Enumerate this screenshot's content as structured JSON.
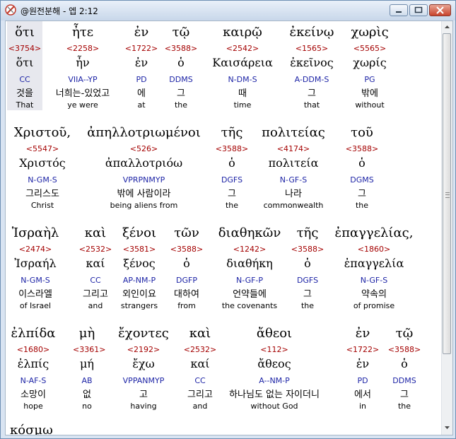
{
  "window": {
    "title": "@원전분해 - 엡 2:12"
  },
  "rows": [
    {
      "words": [
        {
          "greek": "ὅτι",
          "strong": "<3754>",
          "lexeme": "ὅτι",
          "parsing": "CC",
          "korean": "것을",
          "english": "That"
        },
        {
          "greek": "ἦτε",
          "strong": "<2258>",
          "lexeme": "ἦν",
          "parsing": "VIIA--YP",
          "korean": "너희는-있었고",
          "english": "ye were"
        },
        {
          "greek": "ἐν",
          "strong": "<1722>",
          "lexeme": "ἐν",
          "parsing": "PD",
          "korean": "에",
          "english": "at"
        },
        {
          "greek": "τῷ",
          "strong": "<3588>",
          "lexeme": "ὁ",
          "parsing": "DDMS",
          "korean": "그",
          "english": "the"
        },
        {
          "greek": "καιρῷ",
          "strong": "<2542>",
          "lexeme": "Καισάρεια",
          "parsing": "N-DM-S",
          "korean": "때",
          "english": "time"
        },
        {
          "greek": "ἐκείνῳ",
          "strong": "<1565>",
          "lexeme": "ἐκεῖνος",
          "parsing": "A-DDM-S",
          "korean": "그",
          "english": "that"
        },
        {
          "greek": "χωρὶς",
          "strong": "<5565>",
          "lexeme": "χωρίς",
          "parsing": "PG",
          "korean": "밖에",
          "english": "without"
        }
      ]
    },
    {
      "words": [
        {
          "greek": "Χριστοῦ,",
          "strong": "<5547>",
          "lexeme": "Χριστός",
          "parsing": "N-GM-S",
          "korean": "그리스도",
          "english": "Christ"
        },
        {
          "greek": "ἀπηλλοτριωμένοι",
          "strong": "<526>",
          "lexeme": "ἀπαλλοτριόω",
          "parsing": "VPRPNMYP",
          "korean": "밖에 사람이라",
          "english": "being aliens from"
        },
        {
          "greek": "τῆς",
          "strong": "<3588>",
          "lexeme": "ὁ",
          "parsing": "DGFS",
          "korean": "그",
          "english": "the"
        },
        {
          "greek": "πολιτείας",
          "strong": "<4174>",
          "lexeme": "πολιτεία",
          "parsing": "N-GF-S",
          "korean": "나라",
          "english": "commonwealth"
        },
        {
          "greek": "τοῦ",
          "strong": "<3588>",
          "lexeme": "ὁ",
          "parsing": "DGMS",
          "korean": "그",
          "english": "the"
        }
      ]
    },
    {
      "words": [
        {
          "greek": "Ἰσραὴλ",
          "strong": "<2474>",
          "lexeme": "Ἰσραήλ",
          "parsing": "N-GM-S",
          "korean": "이스라엘",
          "english": "of Israel"
        },
        {
          "greek": "καὶ",
          "strong": "<2532>",
          "lexeme": "καί",
          "parsing": "CC",
          "korean": "그리고",
          "english": "and"
        },
        {
          "greek": "ξένοι",
          "strong": "<3581>",
          "lexeme": "ξένος",
          "parsing": "AP-NM-P",
          "korean": "외인이요",
          "english": "strangers"
        },
        {
          "greek": "τῶν",
          "strong": "<3588>",
          "lexeme": "ὁ",
          "parsing": "DGFP",
          "korean": "대하여",
          "english": "from"
        },
        {
          "greek": "διαθηκῶν",
          "strong": "<1242>",
          "lexeme": "διαθήκη",
          "parsing": "N-GF-P",
          "korean": "언약들에",
          "english": "the covenants"
        },
        {
          "greek": "τῆς",
          "strong": "<3588>",
          "lexeme": "ὁ",
          "parsing": "DGFS",
          "korean": "그",
          "english": "the"
        },
        {
          "greek": "ἐπαγγελίας,",
          "strong": "<1860>",
          "lexeme": "ἐπαγγελία",
          "parsing": "N-GF-S",
          "korean": "약속의",
          "english": "of promise"
        }
      ]
    },
    {
      "words": [
        {
          "greek": "ἐλπίδα",
          "strong": "<1680>",
          "lexeme": "ἐλπίς",
          "parsing": "N-AF-S",
          "korean": "소망이",
          "english": "hope"
        },
        {
          "greek": "μὴ",
          "strong": "<3361>",
          "lexeme": "μή",
          "parsing": "AB",
          "korean": "없",
          "english": "no"
        },
        {
          "greek": "ἔχοντες",
          "strong": "<2192>",
          "lexeme": "ἔχω",
          "parsing": "VPPANMYP",
          "korean": "고",
          "english": "having"
        },
        {
          "greek": "καὶ",
          "strong": "<2532>",
          "lexeme": "καί",
          "parsing": "CC",
          "korean": "그리고",
          "english": "and"
        },
        {
          "greek": "ἄθεοι",
          "strong": "<112>",
          "lexeme": "ἄθεος",
          "parsing": "A--NM-P",
          "korean": "하나님도 없는 자이더니",
          "english": "without God"
        },
        {
          "greek": "ἐν",
          "strong": "<1722>",
          "lexeme": "ἐν",
          "parsing": "PD",
          "korean": "에서",
          "english": "in"
        },
        {
          "greek": "τῷ",
          "strong": "<3588>",
          "lexeme": "ὁ",
          "parsing": "DDMS",
          "korean": "그",
          "english": "the"
        }
      ]
    }
  ],
  "partial_next_word": "κόσμῳ",
  "colors": {
    "strong": "#a40000",
    "parsing": "#1d24a6",
    "selection": "#e7e8ee"
  },
  "icons": {
    "app": "compass-icon",
    "minimize": "minimize-icon",
    "maximize": "maximize-icon",
    "close": "close-icon",
    "scroll_up": "arrow-up-icon",
    "scroll_down": "arrow-down-icon"
  }
}
